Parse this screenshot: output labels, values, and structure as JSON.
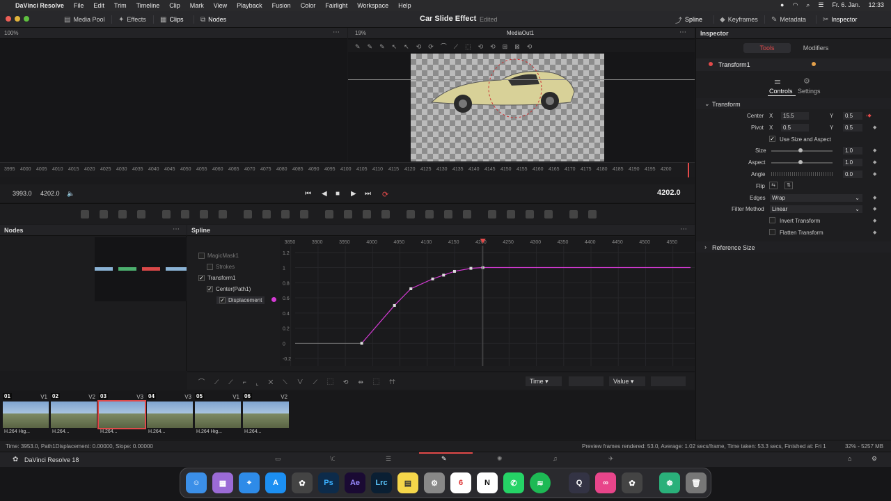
{
  "menubar": {
    "app": "DaVinci Resolve",
    "items": [
      "File",
      "Edit",
      "Trim",
      "Timeline",
      "Clip",
      "Mark",
      "View",
      "Playback",
      "Fusion",
      "Color",
      "Fairlight",
      "Workspace",
      "Help"
    ],
    "date": "Fr. 6. Jan.",
    "time": "12:33"
  },
  "toolbar": {
    "zoom_left": "100%",
    "media_pool": "Media Pool",
    "effects": "Effects",
    "clips": "Clips",
    "nodes": "Nodes",
    "project_title": "Car Slide Effect",
    "edited": "Edited",
    "spline": "Spline",
    "keyframes": "Keyframes",
    "metadata": "Metadata",
    "inspector": "Inspector"
  },
  "viewer": {
    "zoom": "19%",
    "name": "MediaOut1"
  },
  "ruler": {
    "ticks": [
      "3995",
      "4000",
      "4005",
      "4010",
      "4015",
      "4020",
      "4025",
      "4030",
      "4035",
      "4040",
      "4045",
      "4050",
      "4055",
      "4060",
      "4065",
      "4070",
      "4075",
      "4080",
      "4085",
      "4090",
      "4095",
      "4100",
      "4105",
      "4110",
      "4115",
      "4120",
      "4125",
      "4130",
      "4135",
      "4140",
      "4145",
      "4150",
      "4155",
      "4160",
      "4165",
      "4170",
      "4175",
      "4180",
      "4185",
      "4190",
      "4195",
      "4200"
    ]
  },
  "transport": {
    "start": "3993.0",
    "end": "4202.0",
    "current": "4202.0"
  },
  "nodes_panel": {
    "title": "Nodes"
  },
  "spline_panel": {
    "title": "Spline",
    "tree": [
      "MagicMask1",
      "Strokes",
      "Transform1",
      "Center(Path1)",
      "Displacement"
    ],
    "x_ticks": [
      "3850",
      "3900",
      "3950",
      "4000",
      "4050",
      "4100",
      "4150",
      "4200",
      "4250",
      "4300",
      "4350",
      "4400",
      "4450",
      "4500",
      "4550"
    ],
    "y_ticks": [
      "1.2",
      "1",
      "0.8",
      "0.6",
      "0.4",
      "0.2",
      "0",
      "-0.2"
    ],
    "time_label": "Time",
    "value_label": "Value"
  },
  "clips": [
    {
      "num": "01",
      "track": "V1",
      "label": "H.264 Hig..."
    },
    {
      "num": "02",
      "track": "V2",
      "label": "H.264..."
    },
    {
      "num": "03",
      "track": "V3",
      "label": "H.264..."
    },
    {
      "num": "04",
      "track": "V3",
      "label": "H.264..."
    },
    {
      "num": "05",
      "track": "V1",
      "label": "H.264 Hig..."
    },
    {
      "num": "06",
      "track": "V2",
      "label": "H.264..."
    }
  ],
  "status": {
    "left": "Time: 3953.0,    Path1Displacement:  0.00000,   Slope: 0.00000",
    "right": "Preview frames rendered: 53.0, Average: 1.02 secs/frame, Time taken: 53.3 secs, Finished at: Fri 1",
    "mem": "32% - 5257 MB"
  },
  "pages": {
    "app_name": "DaVinci Resolve 18"
  },
  "inspector": {
    "title": "Inspector",
    "tab_tools": "Tools",
    "tab_modifiers": "Modifiers",
    "node": "Transform1",
    "controls": "Controls",
    "settings": "Settings",
    "section": "Transform",
    "center_label": "Center",
    "center_x": "15.5",
    "center_y": "0.5",
    "pivot_label": "Pivot",
    "pivot_x": "0.5",
    "pivot_y": "0.5",
    "use_size": "Use Size and Aspect",
    "size_label": "Size",
    "size_val": "1.0",
    "aspect_label": "Aspect",
    "aspect_val": "1.0",
    "angle_label": "Angle",
    "angle_val": "0.0",
    "flip_label": "Flip",
    "edges_label": "Edges",
    "edges_val": "Wrap",
    "filter_label": "Filter Method",
    "filter_val": "Linear",
    "invert": "Invert Transform",
    "flatten": "Flatten Transform",
    "reference": "Reference Size",
    "x": "X",
    "y": "Y"
  },
  "spline_curve": {
    "points": [
      [
        3980,
        0
      ],
      [
        4040,
        0.5
      ],
      [
        4070,
        0.72
      ],
      [
        4110,
        0.85
      ],
      [
        4130,
        0.9
      ],
      [
        4150,
        0.95
      ],
      [
        4180,
        0.99
      ],
      [
        4202,
        1.0
      ]
    ]
  }
}
